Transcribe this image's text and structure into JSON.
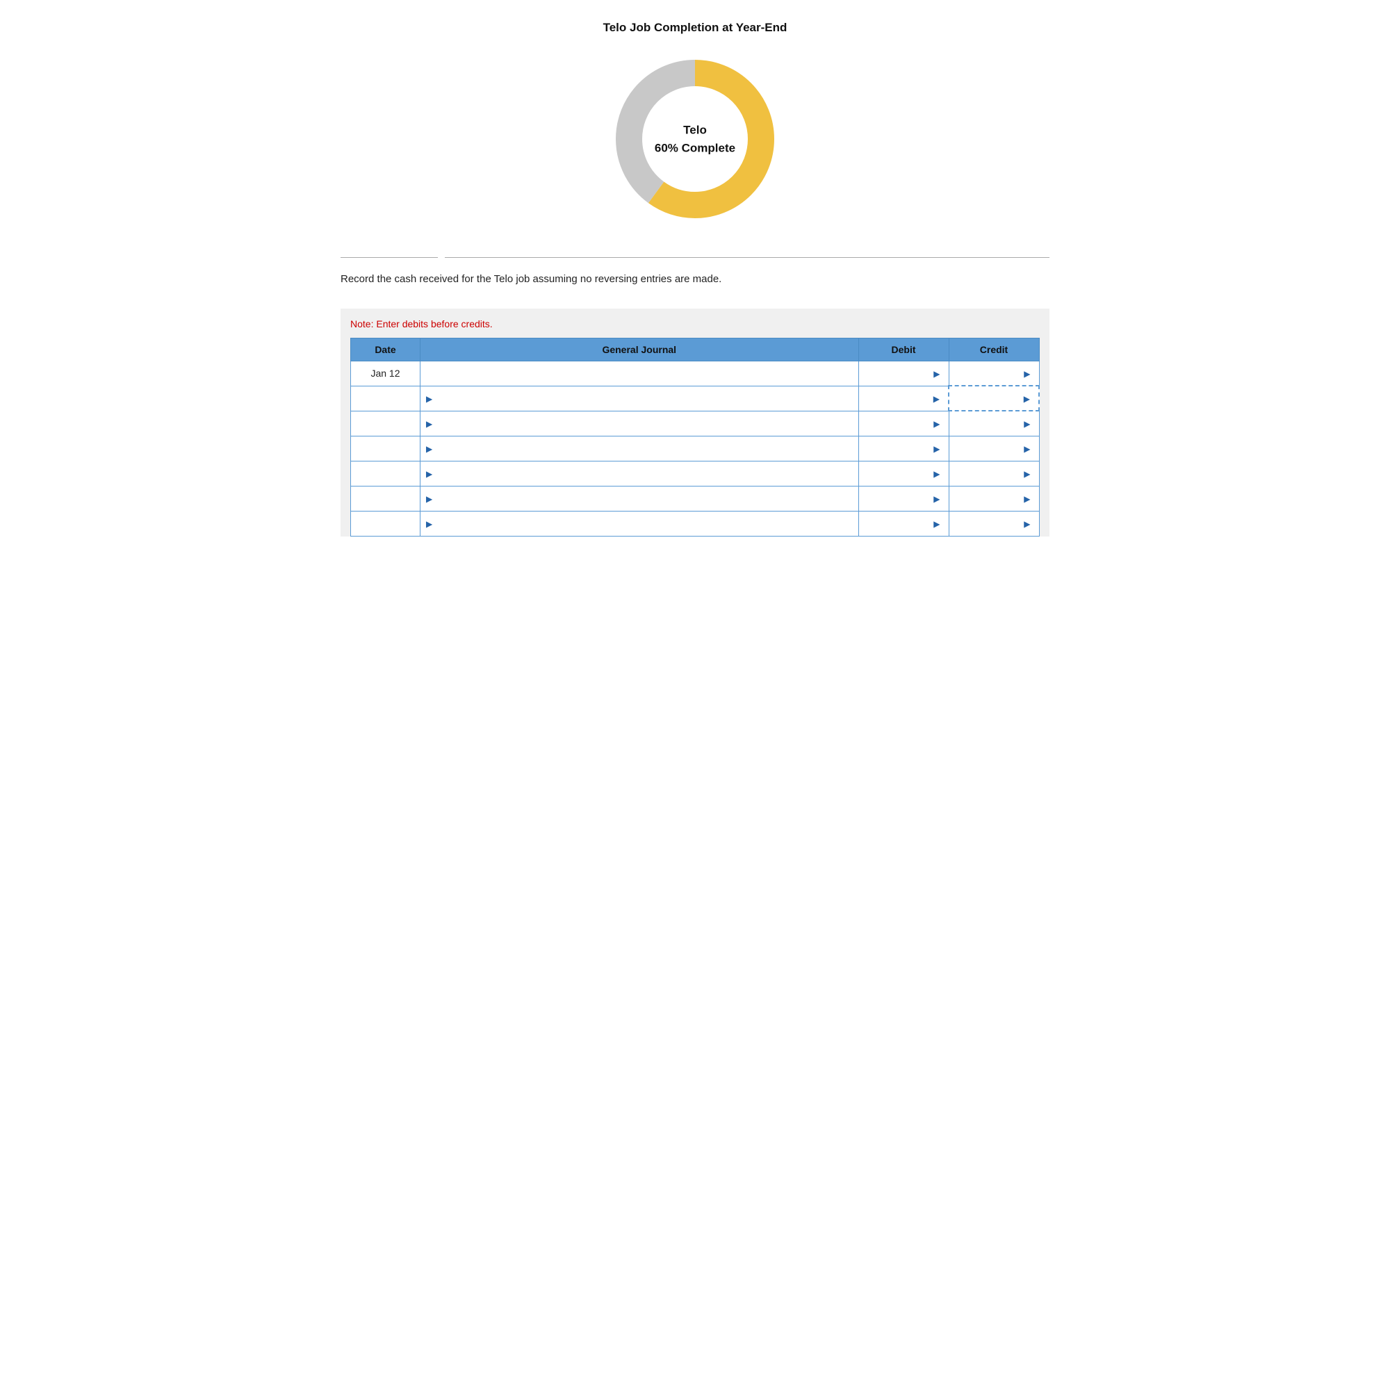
{
  "chart": {
    "title": "Telo Job Completion at Year-End",
    "center_line1": "Telo",
    "center_line2": "60% Complete",
    "percentage": 60,
    "color_complete": "#f0c040",
    "color_incomplete": "#c8c8c8"
  },
  "instruction": {
    "text": "Record the cash received for the Telo job assuming no reversing entries are made."
  },
  "table": {
    "note": "Note: Enter debits before credits.",
    "headers": {
      "date": "Date",
      "journal": "General Journal",
      "debit": "Debit",
      "credit": "Credit"
    },
    "rows": [
      {
        "date": "Jan 12",
        "journal": "",
        "debit": "",
        "credit": ""
      },
      {
        "date": "",
        "journal": "",
        "debit": "",
        "credit": "",
        "credit_dashed": true
      },
      {
        "date": "",
        "journal": "",
        "debit": "",
        "credit": ""
      },
      {
        "date": "",
        "journal": "",
        "debit": "",
        "credit": ""
      },
      {
        "date": "",
        "journal": "",
        "debit": "",
        "credit": ""
      },
      {
        "date": "",
        "journal": "",
        "debit": "",
        "credit": ""
      },
      {
        "date": "",
        "journal": "",
        "debit": "",
        "credit": ""
      }
    ]
  }
}
